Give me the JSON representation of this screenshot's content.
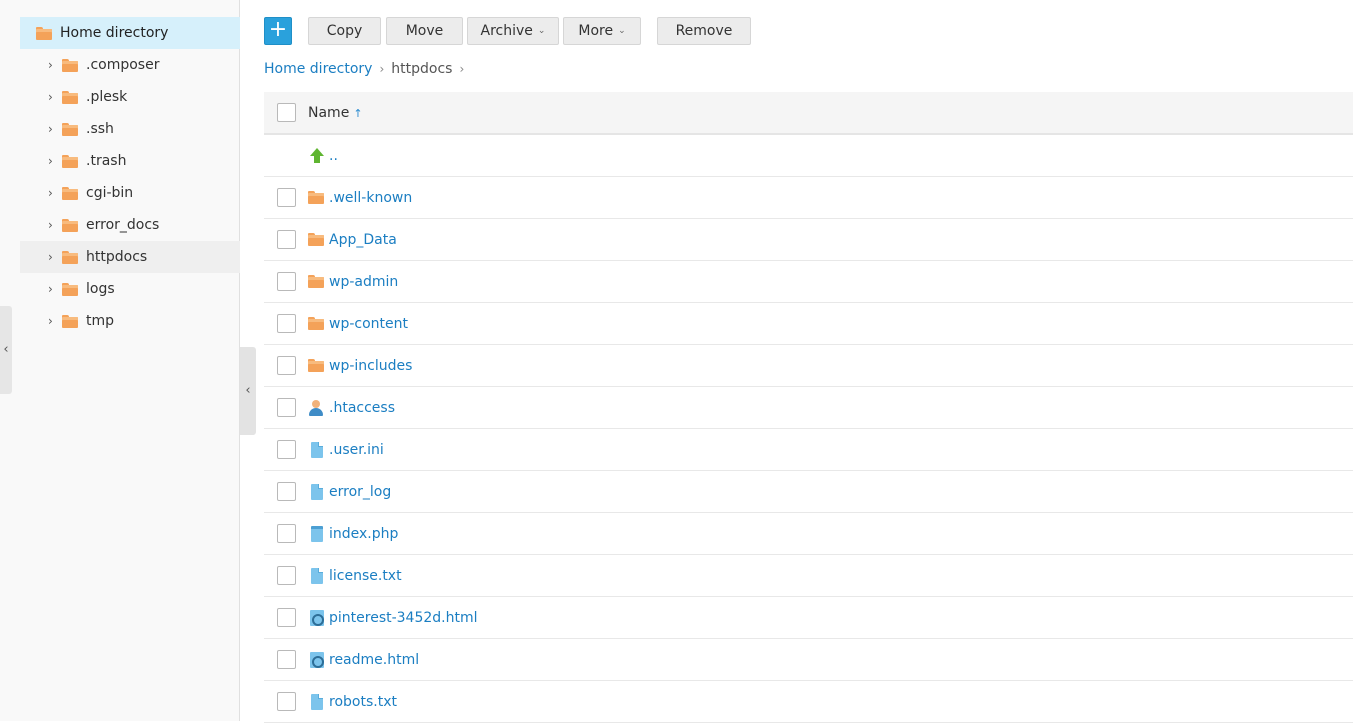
{
  "tree": {
    "root_label": "Home directory",
    "items": [
      {
        "label": ".composer"
      },
      {
        "label": ".plesk"
      },
      {
        "label": ".ssh"
      },
      {
        "label": ".trash"
      },
      {
        "label": "cgi-bin"
      },
      {
        "label": "error_docs"
      },
      {
        "label": "httpdocs",
        "selected": true
      },
      {
        "label": "logs"
      },
      {
        "label": "tmp"
      }
    ]
  },
  "toolbar": {
    "add_label": "+",
    "copy_label": "Copy",
    "move_label": "Move",
    "archive_label": "Archive",
    "more_label": "More",
    "remove_label": "Remove"
  },
  "breadcrumb": {
    "home": "Home directory",
    "current": "httpdocs",
    "separator": "›"
  },
  "table": {
    "name_header": "Name",
    "sort_indicator": "↑",
    "parent_label": "..",
    "rows": [
      {
        "name": ".well-known",
        "icon": "folder-icon"
      },
      {
        "name": "App_Data",
        "icon": "folder-icon"
      },
      {
        "name": "wp-admin",
        "icon": "folder-icon"
      },
      {
        "name": "wp-content",
        "icon": "folder-icon"
      },
      {
        "name": "wp-includes",
        "icon": "folder-icon"
      },
      {
        "name": ".htaccess",
        "icon": "user-icon"
      },
      {
        "name": ".user.ini",
        "icon": "file-icon"
      },
      {
        "name": "error_log",
        "icon": "file-icon"
      },
      {
        "name": "index.php",
        "icon": "php-file-icon"
      },
      {
        "name": "license.txt",
        "icon": "file-icon"
      },
      {
        "name": "pinterest-3452d.html",
        "icon": "web-file-icon"
      },
      {
        "name": "readme.html",
        "icon": "web-file-icon"
      },
      {
        "name": "robots.txt",
        "icon": "file-icon"
      }
    ]
  },
  "colors": {
    "accent": "#2aa1dc",
    "link": "#1b7ec2",
    "folder": "#f4a259",
    "tree_root_bg": "#d6f0fb"
  }
}
